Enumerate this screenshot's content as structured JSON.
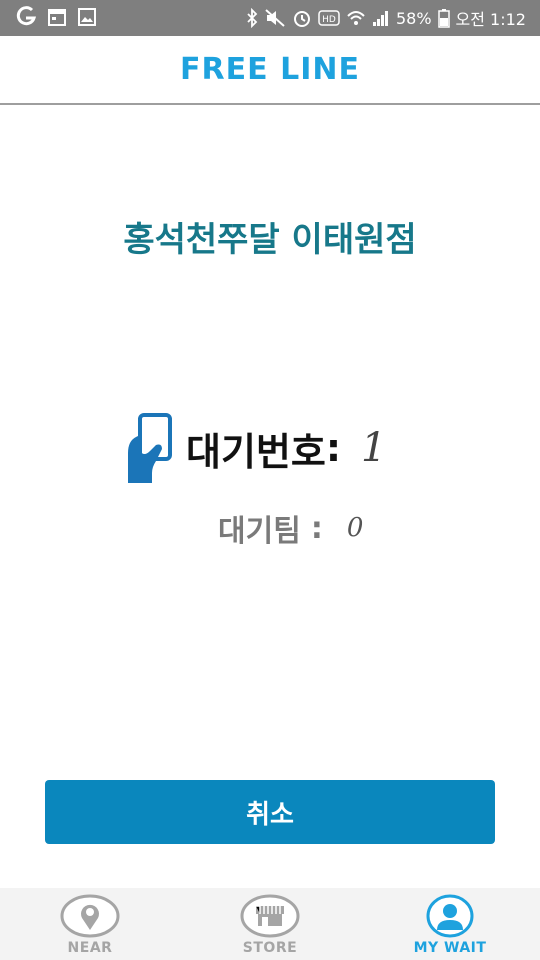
{
  "status_bar": {
    "left_icons": [
      "g-app-icon",
      "calendar-icon",
      "image-icon"
    ],
    "right_icons": [
      "bluetooth-icon",
      "mute-icon",
      "alarm-icon",
      "hd-icon",
      "wifi-icon",
      "signal-icon",
      "battery-icon"
    ],
    "battery_percent": "58%",
    "time": "오전 1:12"
  },
  "header": {
    "brand": "FREE LINE"
  },
  "store": {
    "name": "홍석천쭈달 이태원점"
  },
  "wait": {
    "number_label": "대기번호",
    "number_colon": ":",
    "number_value": "1",
    "teams_label": "대기팀",
    "teams_colon": ":",
    "teams_value": "0"
  },
  "actions": {
    "cancel_label": "취소"
  },
  "nav": {
    "items": [
      {
        "label": "NEAR",
        "icon": "location-pin-icon",
        "active": false
      },
      {
        "label": "STORE",
        "icon": "store-icon",
        "active": false
      },
      {
        "label": "MY WAIT",
        "icon": "person-icon",
        "active": true
      }
    ]
  },
  "colors": {
    "brand": "#1ea2de",
    "store_title": "#17788a",
    "button": "#0a87bd",
    "nav_active": "#1ea2de",
    "nav_inactive": "#a5a5a5",
    "status_bar": "#7f7f7f"
  }
}
